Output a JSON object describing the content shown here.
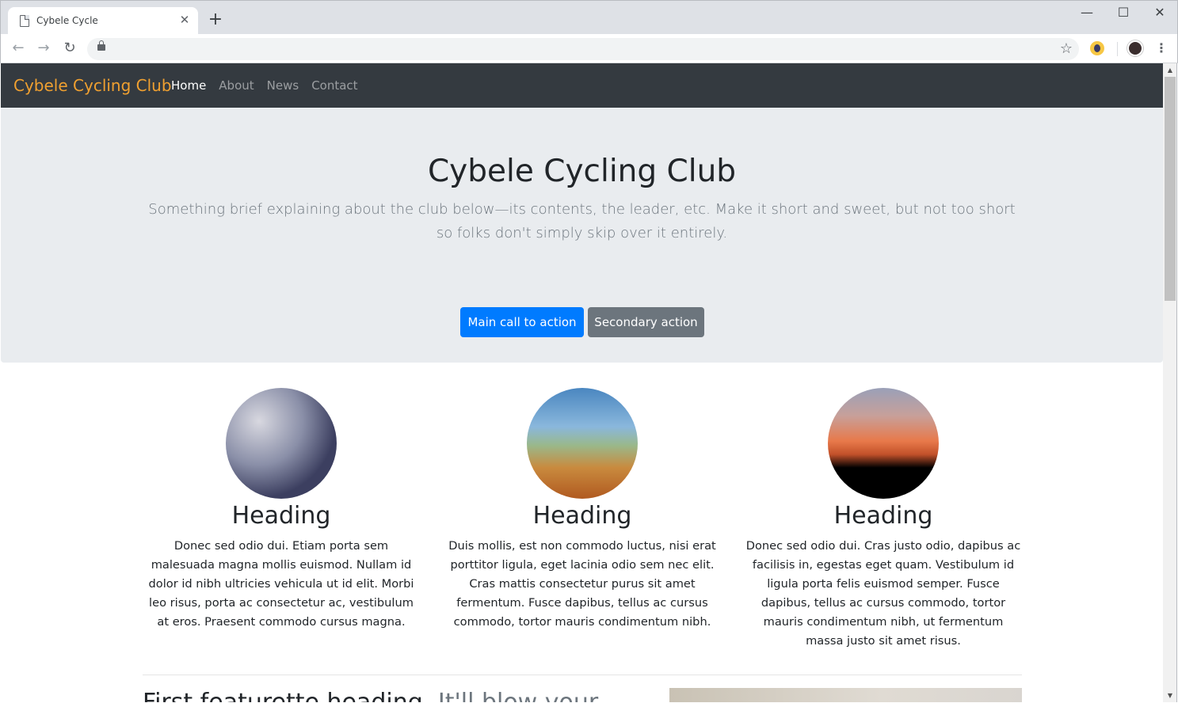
{
  "browser": {
    "tab_title": "Cybele Cycle",
    "tab_close": "✕",
    "new_tab": "+",
    "window_controls": {
      "minimize": "—",
      "maximize": "☐",
      "close": "✕"
    },
    "back_icon": "←",
    "forward_icon": "→",
    "reload_icon": "↻",
    "url": "",
    "star_icon": "☆",
    "menu_icon": "⋮"
  },
  "nav": {
    "brand": "Cybele Cycling Club",
    "links": [
      "Home",
      "About",
      "News",
      "Contact"
    ],
    "active_index": 0,
    "brand_color": "#f0a030"
  },
  "hero": {
    "title": "Cybele Cycling Club",
    "lead": "Something brief explaining about the club below—its contents, the leader, etc. Make it short and sweet, but not too short so folks don't simply skip over it entirely.",
    "primary_button": "Main call to action",
    "secondary_button": "Secondary action"
  },
  "columns": [
    {
      "image_icon": "cyclists-racing-photo",
      "heading": "Heading",
      "text": "Donec sed odio dui. Etiam porta sem malesuada magna mollis euismod. Nullam id dolor id nibh ultricies vehicula ut id elit. Morbi leo risus, porta ac consectetur ac, vestibulum at eros. Praesent commodo cursus magna."
    },
    {
      "image_icon": "mountain-trail-photo",
      "heading": "Heading",
      "text": "Duis mollis, est non commodo luctus, nisi erat porttitor ligula, eget lacinia odio sem nec elit. Cras mattis consectetur purus sit amet fermentum. Fusce dapibus, tellus ac cursus commodo, tortor mauris condimentum nibh."
    },
    {
      "image_icon": "bikes-sunset-photo",
      "heading": "Heading",
      "text": "Donec sed odio dui. Cras justo odio, dapibus ac facilisis in, egestas eget quam. Vestibulum id ligula porta felis euismod semper. Fusce dapibus, tellus ac cursus commodo, tortor mauris condimentum nibh, ut fermentum massa justo sit amet risus."
    }
  ],
  "featurette": {
    "heading": "First featurette heading.",
    "muted": "It'll blow your"
  },
  "scrollbar": {
    "up": "▲",
    "down": "▼"
  }
}
